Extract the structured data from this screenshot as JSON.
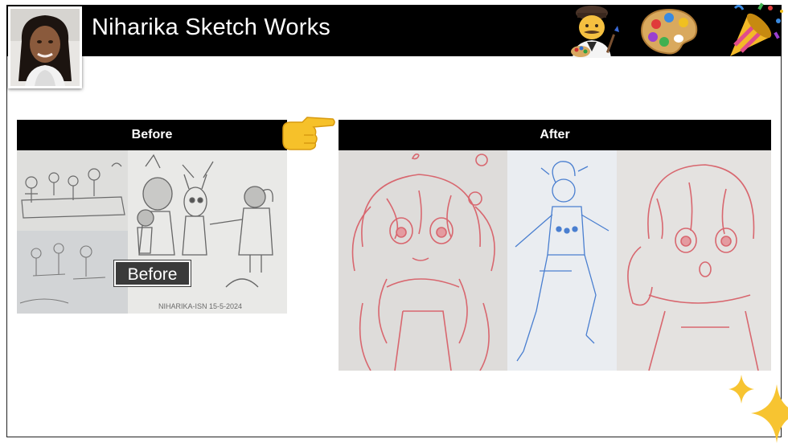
{
  "header": {
    "title": "Niharika Sketch Works",
    "emojis": [
      "artist-icon",
      "palette-icon",
      "party-popper-icon"
    ]
  },
  "before_section": {
    "header_label": "Before",
    "overlay_label": "Before",
    "photo_text": "NIHARIKA-ISN 15-5-2024"
  },
  "after_section": {
    "header_label": "After"
  },
  "decorations": [
    "pointing-hand-icon",
    "sparkles-icon"
  ],
  "colors": {
    "header_bg": "#000000",
    "page_bg": "#ffffff",
    "label_bg": "#3a3a3a",
    "red_pencil": "#d8676f",
    "blue_pen": "#4a7fd0"
  }
}
